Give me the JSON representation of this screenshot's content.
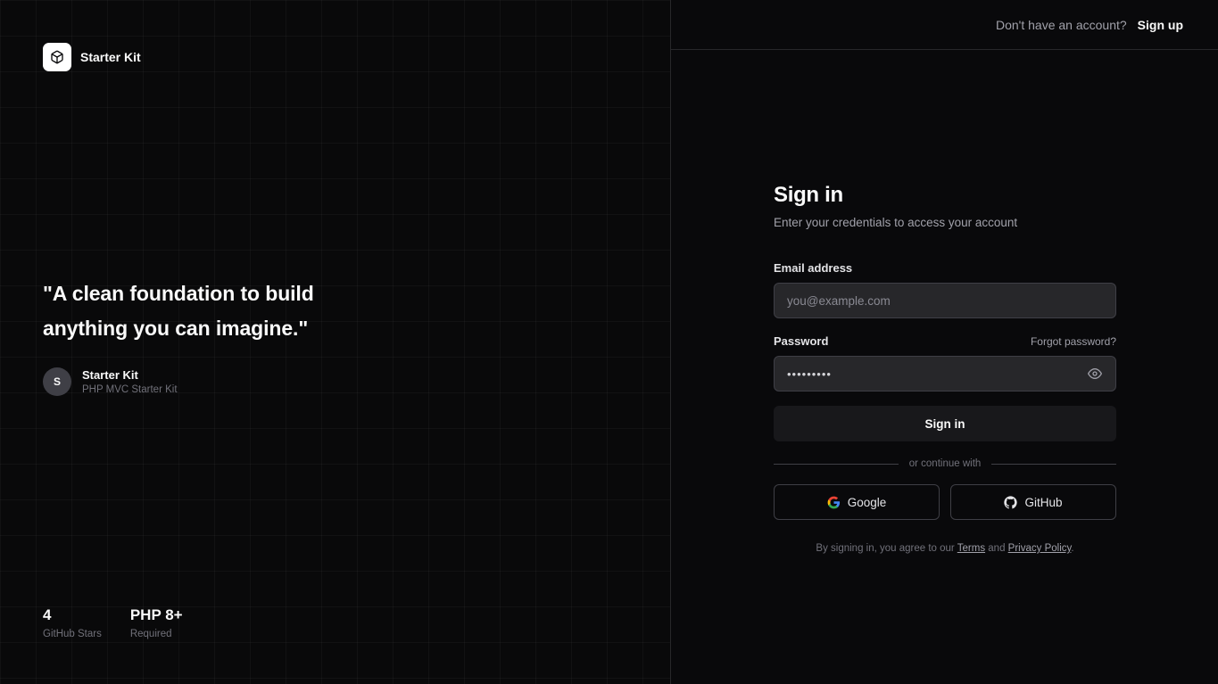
{
  "brand": {
    "name": "Starter Kit",
    "logo_icon": "cube-icon"
  },
  "testimonial": {
    "quote_line1": "\"A clean foundation to build",
    "quote_line2": "anything you can imagine.\"",
    "avatar_initial": "S",
    "author_name": "Starter Kit",
    "author_role": "PHP MVC Starter Kit"
  },
  "stats": [
    {
      "value": "4",
      "label": "GitHub Stars"
    },
    {
      "value": "PHP 8+",
      "label": "Required"
    }
  ],
  "topbar": {
    "prompt": "Don't have an account?",
    "signup_label": "Sign up"
  },
  "form": {
    "title": "Sign in",
    "subtitle": "Enter your credentials to access your account",
    "email_label": "Email address",
    "email_placeholder": "you@example.com",
    "password_label": "Password",
    "forgot_label": "Forgot password?",
    "password_mask": "•••••••••",
    "submit_label": "Sign in",
    "divider_label": "or continue with",
    "google_label": "Google",
    "github_label": "GitHub",
    "legal_prefix": "By signing in, you agree to our",
    "terms_label": "Terms",
    "legal_and": "and",
    "privacy_label": "Privacy Policy",
    "legal_suffix": "."
  },
  "colors": {
    "background": "#0a0a0b",
    "input_bg": "#27272a",
    "border": "#3f3f46",
    "muted": "#a1a1aa"
  }
}
